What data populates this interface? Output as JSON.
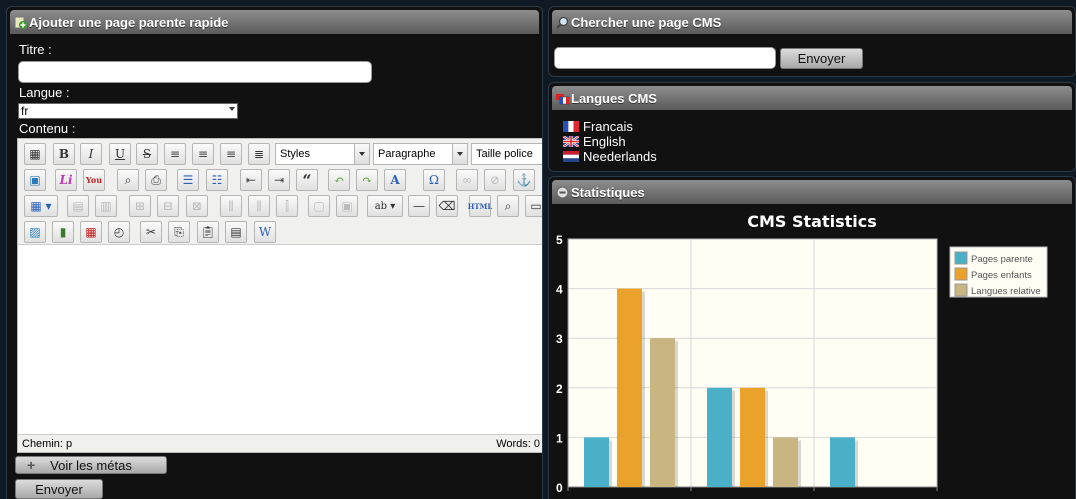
{
  "quick_add": {
    "title": "Ajouter une page parente rapide",
    "titre_label": "Titre :",
    "titre_value": "",
    "langue_label": "Langue :",
    "langue_value": "fr",
    "contenu_label": "Contenu :",
    "toolbar": {
      "styles": "Styles",
      "format": "Paragraphe",
      "font_size": "Taille police"
    },
    "status_path": "Chemin: p",
    "status_words": "Words: 0",
    "meta_button": "Voir les métas",
    "submit_button": "Envoyer"
  },
  "search": {
    "title": "Chercher une page CMS",
    "input_value": "",
    "button": "Envoyer"
  },
  "languages": {
    "title": "Langues CMS",
    "items": [
      {
        "label": "Francais",
        "flag": "fr-flag-icon"
      },
      {
        "label": "English",
        "flag": "uk-flag-icon"
      },
      {
        "label": "Neederlands",
        "flag": "nl-flag-icon"
      }
    ]
  },
  "stats": {
    "title": "Statistiques"
  },
  "colors": {
    "teal": "#4ab0c8",
    "orange": "#eaa22b",
    "tan": "#c8b582"
  },
  "chart_data": {
    "type": "bar",
    "title": "CMS Statistics",
    "categories": [
      "",
      "",
      ""
    ],
    "series": [
      {
        "name": "Pages parente",
        "values": [
          1,
          2,
          1
        ],
        "color": "#4ab0c8"
      },
      {
        "name": "Pages enfants",
        "values": [
          4,
          2,
          0
        ],
        "color": "#eaa22b"
      },
      {
        "name": "Langues relative",
        "values": [
          3,
          1,
          0
        ],
        "color": "#c8b582"
      }
    ],
    "ylim": [
      0,
      5
    ],
    "yticks": [
      "0",
      "1",
      "2",
      "3",
      "4",
      "5"
    ],
    "grid": true,
    "legend": "top-right"
  }
}
